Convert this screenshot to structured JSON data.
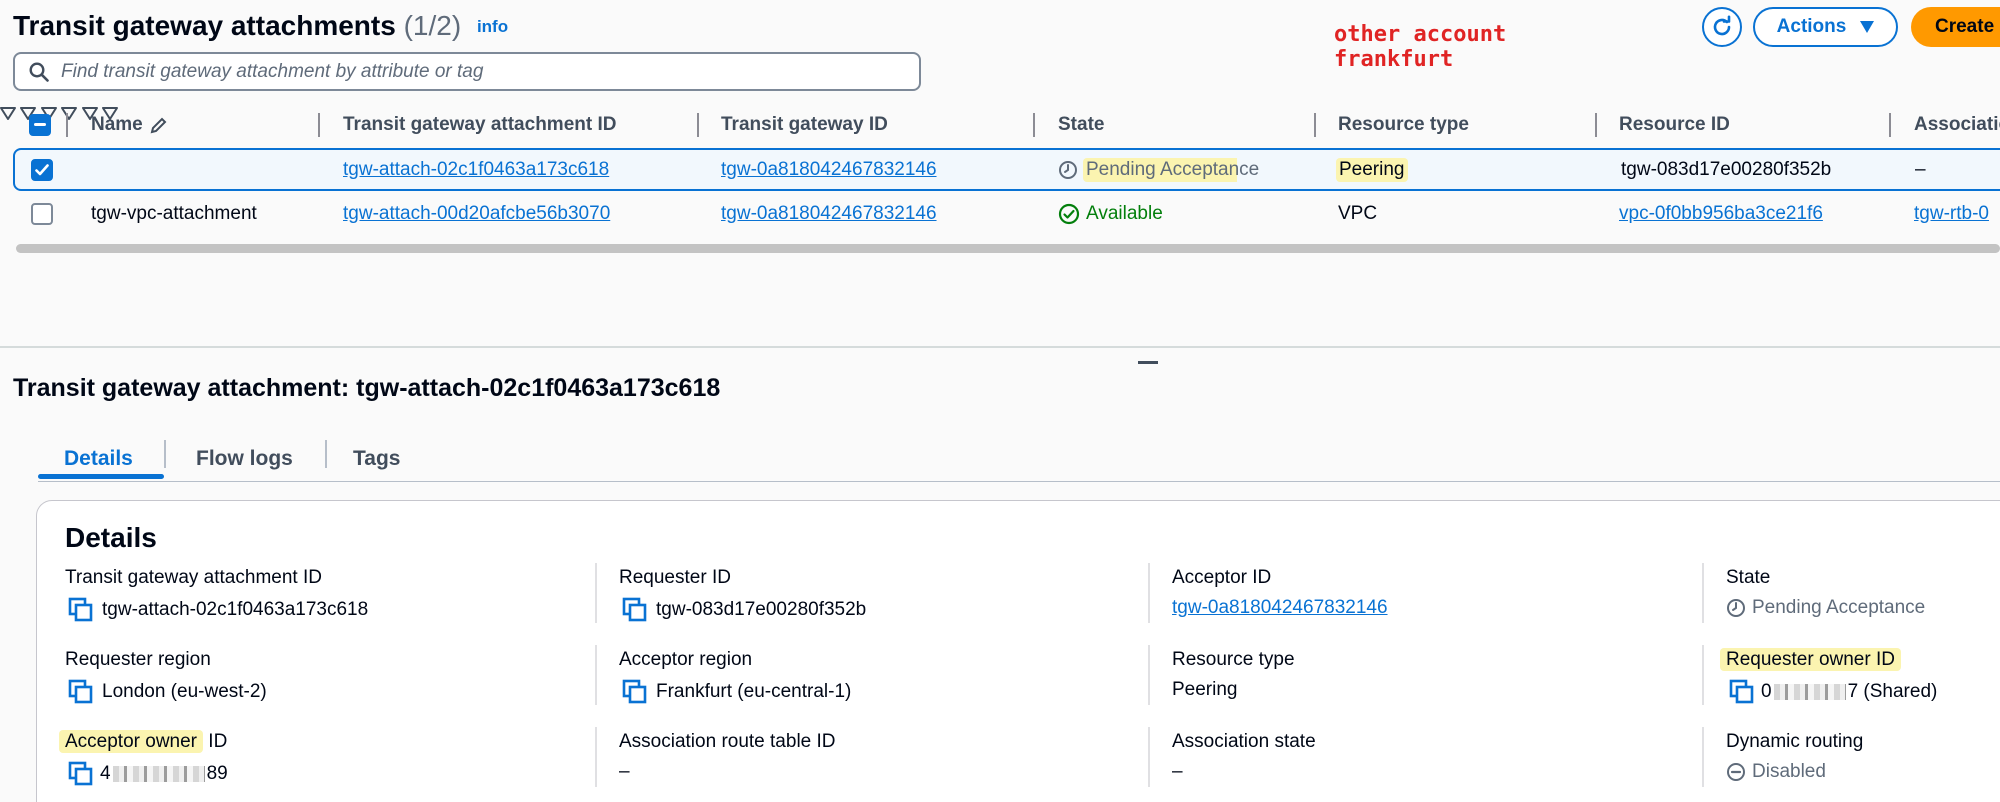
{
  "header": {
    "title": "Transit gateway attachments",
    "count": "(1/2)",
    "info": "info",
    "annotation": "other account\nfrankfurt",
    "actions_label": "Actions",
    "create_label": "Create"
  },
  "search": {
    "placeholder": "Find transit gateway attachment by attribute or tag"
  },
  "table": {
    "columns": [
      "Name",
      "Transit gateway attachment ID",
      "Transit gateway ID",
      "State",
      "Resource type",
      "Resource ID",
      "Associatio"
    ],
    "rows": [
      {
        "name": "",
        "attachment_id": "tgw-attach-02c1f0463a173c618",
        "tgw_id": "tgw-0a818042467832146",
        "state": "Pending Acceptance",
        "resource_type": "Peering",
        "resource_id": "tgw-083d17e00280f352b",
        "association": "–",
        "selected": true
      },
      {
        "name": "tgw-vpc-attachment",
        "attachment_id": "tgw-attach-00d20afcbe56b3070",
        "tgw_id": "tgw-0a818042467832146",
        "state": "Available",
        "resource_type": "VPC",
        "resource_id": "vpc-0f0bb956ba3ce21f6",
        "association": "tgw-rtb-0",
        "selected": false
      }
    ]
  },
  "detail": {
    "title": "Transit gateway attachment: tgw-attach-02c1f0463a173c618",
    "tabs": [
      "Details",
      "Flow logs",
      "Tags"
    ],
    "card_title": "Details",
    "fields": {
      "attachment_id_label": "Transit gateway attachment ID",
      "attachment_id_value": "tgw-attach-02c1f0463a173c618",
      "requester_id_label": "Requester ID",
      "requester_id_value": "tgw-083d17e00280f352b",
      "acceptor_id_label": "Acceptor ID",
      "acceptor_id_value": "tgw-0a818042467832146",
      "state_label": "State",
      "state_value": "Pending Acceptance",
      "requester_region_label": "Requester region",
      "requester_region_value": "London (eu-west-2)",
      "acceptor_region_label": "Acceptor region",
      "acceptor_region_value": "Frankfurt (eu-central-1)",
      "resource_type_label": "Resource type",
      "resource_type_value": "Peering",
      "requester_owner_label": "Requester owner ID",
      "requester_owner_prefix": "0",
      "requester_owner_suffix": "7 (Shared)",
      "acceptor_owner_label_hl": "Acceptor owner",
      "acceptor_owner_label_rest": " ID",
      "acceptor_owner_prefix": "4",
      "acceptor_owner_suffix": "89",
      "assoc_rt_label": "Association route table ID",
      "assoc_rt_value": "–",
      "assoc_state_label": "Association state",
      "assoc_state_value": "–",
      "dyn_routing_label": "Dynamic routing",
      "dyn_routing_value": "Disabled"
    }
  },
  "colors": {
    "link": "#0972d3",
    "highlight": "#fbf4b0",
    "success": "#037f0c",
    "create": "#ff9900",
    "annotation": "#e02424"
  }
}
